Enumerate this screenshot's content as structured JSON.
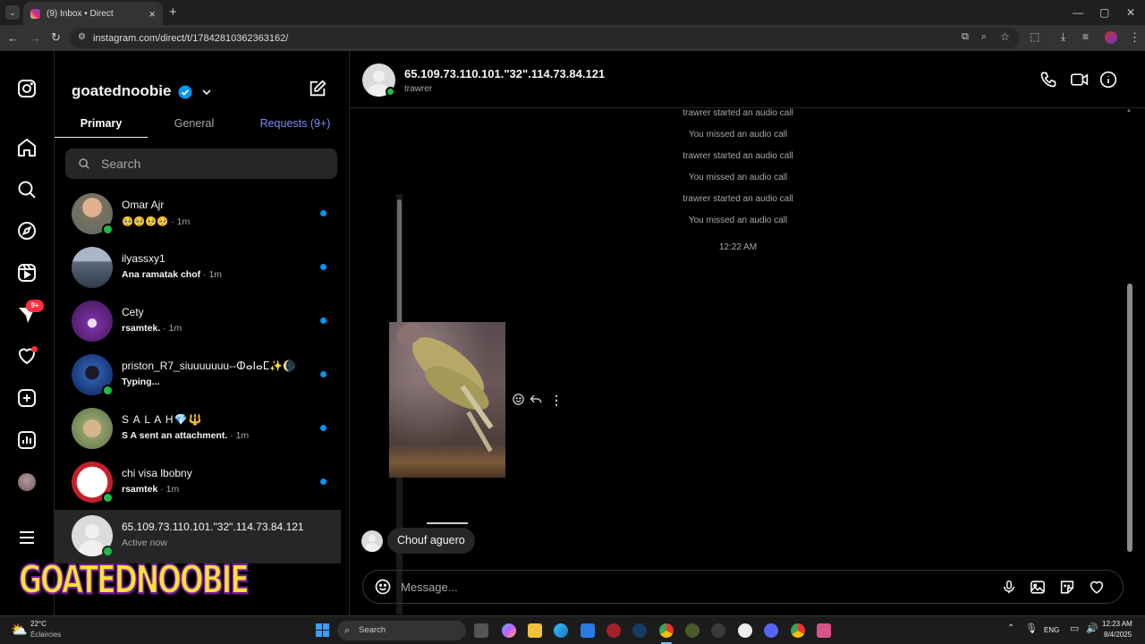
{
  "browser": {
    "tab_title": "(9) Inbox • Direct",
    "url": "instagram.com/direct/t/17842810362363162/",
    "new_tab": "+",
    "tab_close": "×"
  },
  "sidebar_nav": {
    "notification_badge": "9+",
    "icons": [
      "instagram-icon",
      "home-icon",
      "search-icon",
      "explore-icon",
      "reels-icon",
      "messages-icon",
      "heart-icon",
      "create-icon",
      "dashboard-icon",
      "profile-icon",
      "menu-icon"
    ]
  },
  "inbox": {
    "username": "goatednoobie",
    "tabs": {
      "primary": "Primary",
      "general": "General",
      "requests": "Requests (9+)"
    },
    "search_placeholder": "Search",
    "conversations": [
      {
        "name": "Omar Ajr",
        "preview": "🥺🥺🥺🥺",
        "time": "· 1m",
        "online": true,
        "unread": true
      },
      {
        "name": "ilyassxy1",
        "preview": "Ana ramatak chof",
        "time": "· 1m",
        "online": false,
        "unread": true
      },
      {
        "name": "Cety",
        "preview": "rsamtek.",
        "time": "· 1m",
        "online": false,
        "unread": true
      },
      {
        "name": "priston_R7_siuuuuuuu--ⵀⴰⵏⴰⵎ✨🌘",
        "preview": "Typing...",
        "time": "",
        "online": true,
        "unread": true
      },
      {
        "name": "S A L A H💎🔱",
        "preview": "S A sent an attachment.",
        "time": "· 1m",
        "online": false,
        "unread": true
      },
      {
        "name": "chi visa lbobny",
        "preview": "rsamtek",
        "time": "· 1m",
        "online": true,
        "unread": true
      },
      {
        "name": "65.109.73.110.101.\"32\".114.73.84.121",
        "preview": "Active now",
        "time": "",
        "online": true,
        "unread": false
      }
    ]
  },
  "chat": {
    "title": "65.109.73.110.101.\"32\".114.73.84.121",
    "subtitle": "trawrer",
    "system_messages": [
      "trawrer started an audio call",
      "You missed an audio call",
      "trawrer started an audio call",
      "You missed an audio call",
      "trawrer started an audio call",
      "You missed an audio call"
    ],
    "timestamp": "12:22 AM",
    "last_message": "Chouf aguero",
    "composer_placeholder": "Message..."
  },
  "overlay_logo": "GOATEDNOOBIE",
  "taskbar": {
    "weather_temp": "22°C",
    "weather_desc": "Éclaircies",
    "search": "Search",
    "lang": "ENG",
    "time": "12:23 AM",
    "date": "8/4/2025"
  },
  "colors": {
    "accent": "#0095f6",
    "online": "#1fbb4c",
    "badge": "#ff3040",
    "requests": "#7b8cff"
  }
}
